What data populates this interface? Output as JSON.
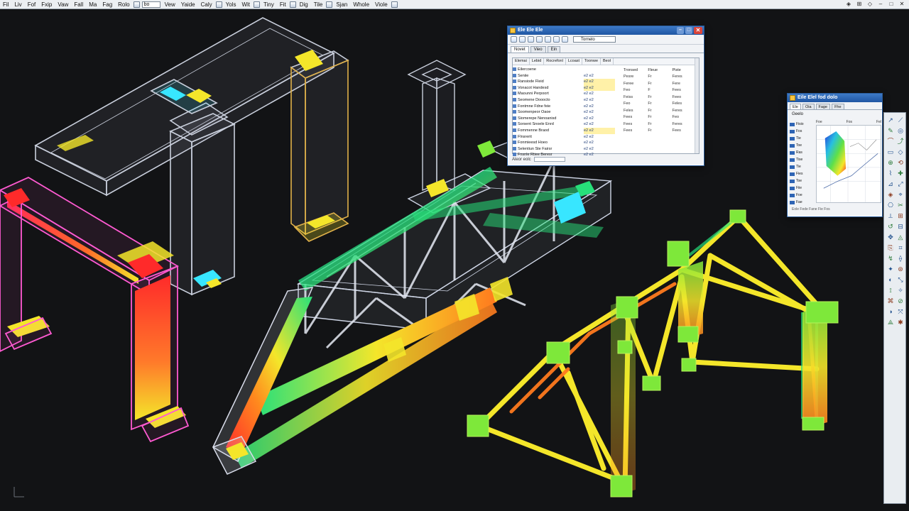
{
  "menubar": {
    "items": [
      "Fil",
      "Liv",
      "Fof",
      "Fxip",
      "Vaw",
      "Fall",
      "Ma",
      "Fag",
      "Rolo",
      "Vew",
      "Yaide",
      "Caly",
      "Yols",
      "Wit",
      "Tiny",
      "Fit",
      "Dig",
      "Tile",
      "Sjan",
      "Whole",
      "Viole"
    ]
  },
  "props_dialog": {
    "title": "Ele Ele Ele",
    "combo": "Tornelo",
    "tabs": [
      "Novet",
      "Vieo",
      "Ein"
    ],
    "columns": [
      "Elemai",
      "Lebid",
      "Rocrefonl",
      "Lcoast",
      "Toonwe",
      "Beol"
    ],
    "tree": [
      {
        "name": "Eilercoene",
        "value": "",
        "hl": false
      },
      {
        "name": "Seniie",
        "value": "e2  e2",
        "hl": false
      },
      {
        "name": "Ransiode Fleid",
        "value": "e2  e2",
        "hl": true
      },
      {
        "name": "Vonacot Handesd",
        "value": "e2  e2",
        "hl": true
      },
      {
        "name": "Maounni Perpoort",
        "value": "e2  e2",
        "hl": false
      },
      {
        "name": "Seomene Dooocto",
        "value": "e2  e2",
        "hl": false
      },
      {
        "name": "Fontmne Fdne feie",
        "value": "e2  e2",
        "hl": false
      },
      {
        "name": "Soomenpeor Oaoe",
        "value": "e2  e2",
        "hl": false
      },
      {
        "name": "Siomerepe Nenoanisd",
        "value": "e2  e2",
        "hl": false
      },
      {
        "name": "Sorsent Snoele Enrd",
        "value": "e2  e2",
        "hl": false
      },
      {
        "name": "Fommenne Braod",
        "value": "e2  e2",
        "hl": true
      },
      {
        "name": "Flnsrerit",
        "value": "e2  e2",
        "hl": false
      },
      {
        "name": "Fonmieesd Hoeo",
        "value": "e2  e2",
        "hl": false
      },
      {
        "name": "Selentiun Ste Fairsr",
        "value": "e2  e2",
        "hl": false
      },
      {
        "name": "Fnsnle Rtiee Beresr",
        "value": "e2  e2",
        "hl": false
      }
    ],
    "side_head": [
      "Tronsed",
      "Fleue",
      "Piste"
    ],
    "side_rows": [
      [
        "Pesre",
        "Fr",
        "Feres"
      ],
      [
        "Feree",
        "Fr",
        "Fere"
      ],
      [
        "Feo",
        "F",
        "Fees"
      ],
      [
        "Feiss",
        "Fr",
        "Feeo"
      ],
      [
        "Feo",
        "Fr",
        "Feles"
      ],
      [
        "Feles",
        "Fr",
        "Feres"
      ],
      [
        "Fees",
        "Fr",
        "Feo"
      ],
      [
        "Fees",
        "Fr",
        "Feres"
      ],
      [
        "Fees",
        "Fr",
        "Fees"
      ]
    ],
    "status_label": "Aleor eolc"
  },
  "result_dialog": {
    "title": "Eile Elel fod dolo",
    "tabs": [
      "Ele",
      "Oia",
      "Fage",
      "Fhe"
    ],
    "header": "Geelo",
    "list": [
      "Fisio",
      "Fos",
      "Tie",
      "Toe",
      "Ras",
      "Tise",
      "Tie",
      "Fies",
      "Toe",
      "Fiie",
      "Foe",
      "Fae"
    ],
    "plot_labels": [
      "Foe",
      "Fos",
      "Fel"
    ],
    "footer": "Eole Fede  Fane Fie Fos"
  },
  "colors": {
    "stress_low": "#27e07a",
    "stress_mid": "#f4e62a",
    "stress_high": "#ff2a2a",
    "ghost_edge": "#c9cfdc",
    "selection": "#ff5ad2",
    "accent_cyan": "#38e6ff"
  },
  "icons": [
    "open-icon",
    "save-icon",
    "undo-icon",
    "redo-icon",
    "zoom-icon",
    "rotate-icon",
    "measure-icon",
    "grid-icon"
  ]
}
